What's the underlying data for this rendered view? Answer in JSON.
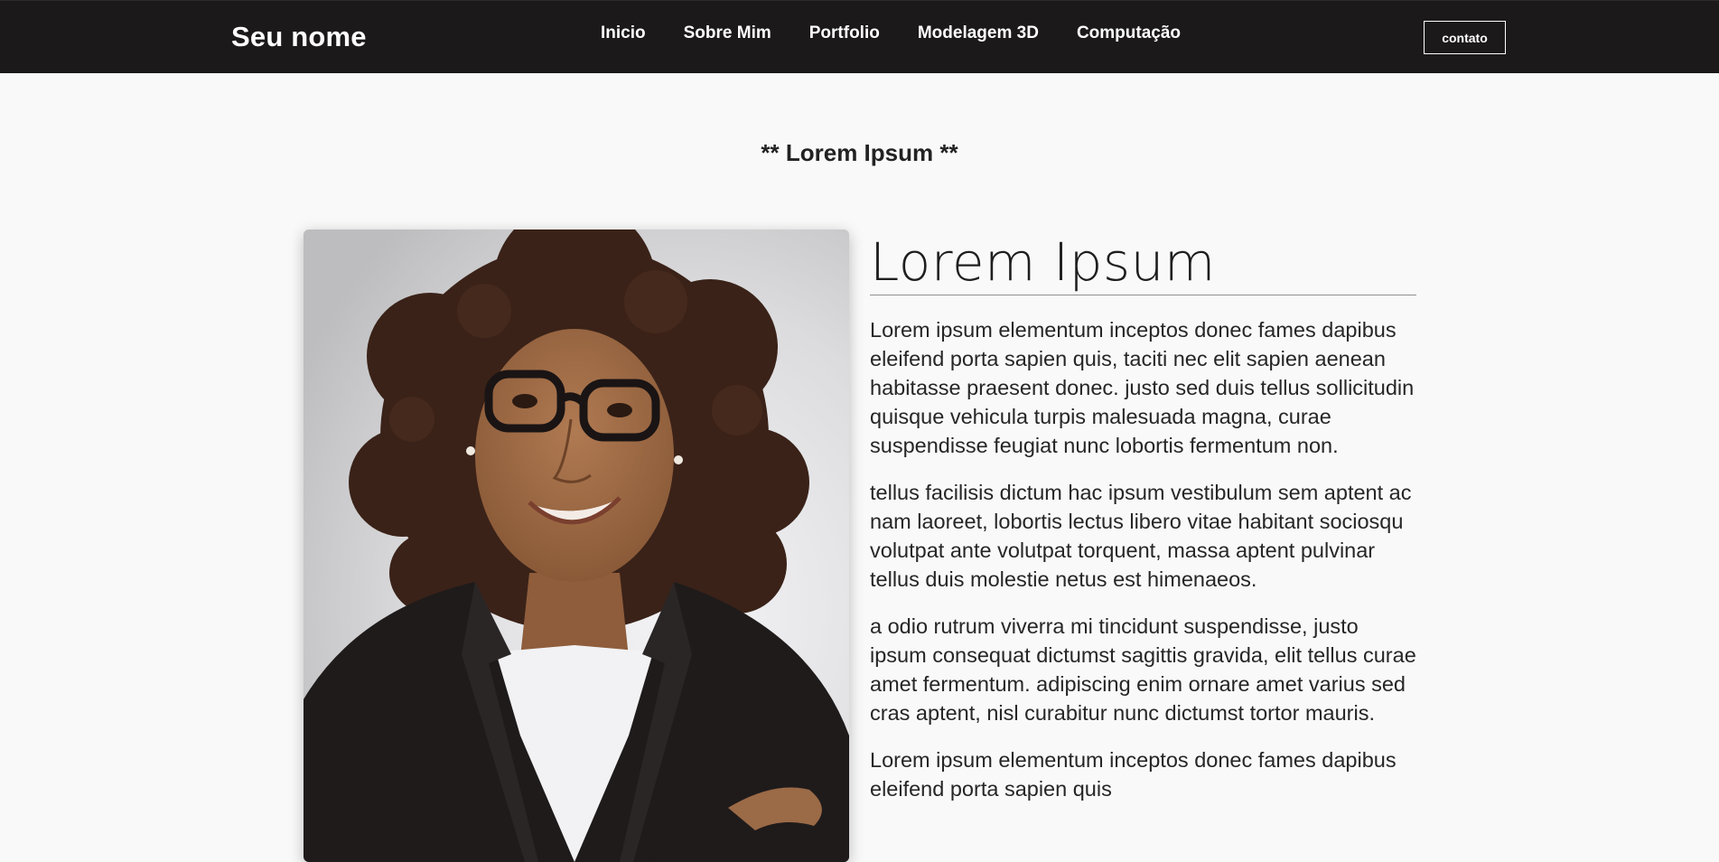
{
  "header": {
    "brand": "Seu nome",
    "nav": [
      "Inicio",
      "Sobre Mim",
      "Portfolio",
      "Modelagem 3D",
      "Computação"
    ],
    "contact_label": "contato"
  },
  "section": {
    "title": "** Lorem Ipsum **"
  },
  "about": {
    "heading": "Lorem Ipsum",
    "paragraphs": [
      "Lorem ipsum elementum inceptos donec fames dapibus eleifend porta sapien quis, taciti nec elit sapien aenean habitasse praesent donec. justo sed duis tellus sollicitudin quisque vehicula turpis malesuada magna, curae suspendisse feugiat nunc lobortis fermentum non.",
      "tellus facilisis dictum hac ipsum vestibulum sem aptent ac nam laoreet, lobortis lectus libero vitae habitant sociosqu volutpat ante volutpat torquent, massa aptent pulvinar tellus duis molestie netus est himenaeos.",
      "a odio rutrum viverra mi tincidunt suspendisse, justo ipsum consequat dictumst sagittis gravida, elit tellus curae amet fermentum. adipiscing enim ornare amet varius sed cras aptent, nisl curabitur nunc dictumst tortor mauris.",
      "Lorem ipsum elementum inceptos donec fames dapibus eleifend porta sapien quis"
    ]
  },
  "colors": {
    "header_bg": "#1b1919",
    "page_bg": "#f9f9f9",
    "text": "#262626"
  }
}
